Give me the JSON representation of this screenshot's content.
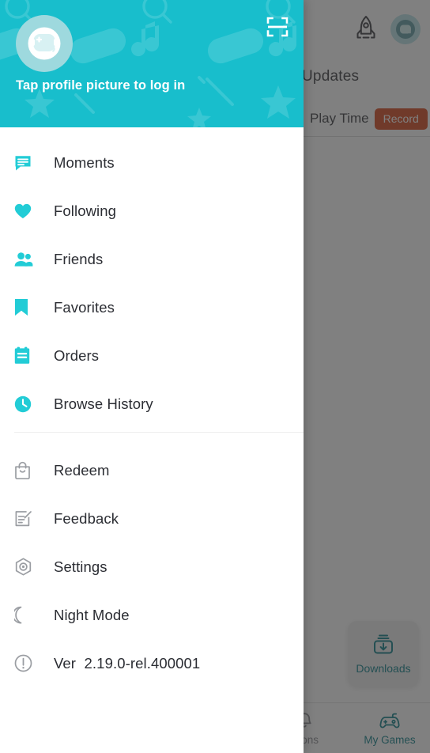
{
  "theme": {
    "brand_teal": "#18becc",
    "icon_accent": "#22ccd6",
    "icon_outline": "#9a9da2",
    "text_primary": "#2b2d33",
    "record_badge": "#d5491e",
    "bg_accent": "#0e7f88"
  },
  "drawer": {
    "header": {
      "avatar_icon": "astronaut-helmet-avatar",
      "login_prompt": "Tap profile picture to log in",
      "scan_icon": "scan-qr-icon"
    },
    "primary_items": [
      {
        "label": "Moments",
        "icon": "chat-bubble-icon"
      },
      {
        "label": "Following",
        "icon": "heart-icon"
      },
      {
        "label": "Friends",
        "icon": "friends-group-icon"
      },
      {
        "label": "Favorites",
        "icon": "bookmark-icon"
      },
      {
        "label": "Orders",
        "icon": "clipboard-icon"
      },
      {
        "label": "Browse History",
        "icon": "clock-icon"
      }
    ],
    "secondary_items": [
      {
        "label": "Redeem",
        "icon": "shopping-bag-icon"
      },
      {
        "label": "Feedback",
        "icon": "edit-form-icon"
      },
      {
        "label": "Settings",
        "icon": "gear-hexagon-icon"
      },
      {
        "label": "Night Mode",
        "icon": "moon-icon"
      },
      {
        "label": "Ver  2.19.0-rel.400001",
        "icon": "info-circle-icon"
      }
    ]
  },
  "background": {
    "topbar": {
      "rocket_icon": "rocket-icon",
      "avatar_icon": "astronaut-helmet-avatar"
    },
    "updates_title": "Updates",
    "play_time_label": "Play Time",
    "record_badge": "Record",
    "downloads_card": {
      "label": "Downloads",
      "icon": "download-box-icon"
    },
    "bottom_nav": [
      {
        "label": "ations",
        "icon": "bell-icon",
        "active": false
      },
      {
        "label": "My Games",
        "icon": "gamepad-icon",
        "active": true
      }
    ]
  }
}
